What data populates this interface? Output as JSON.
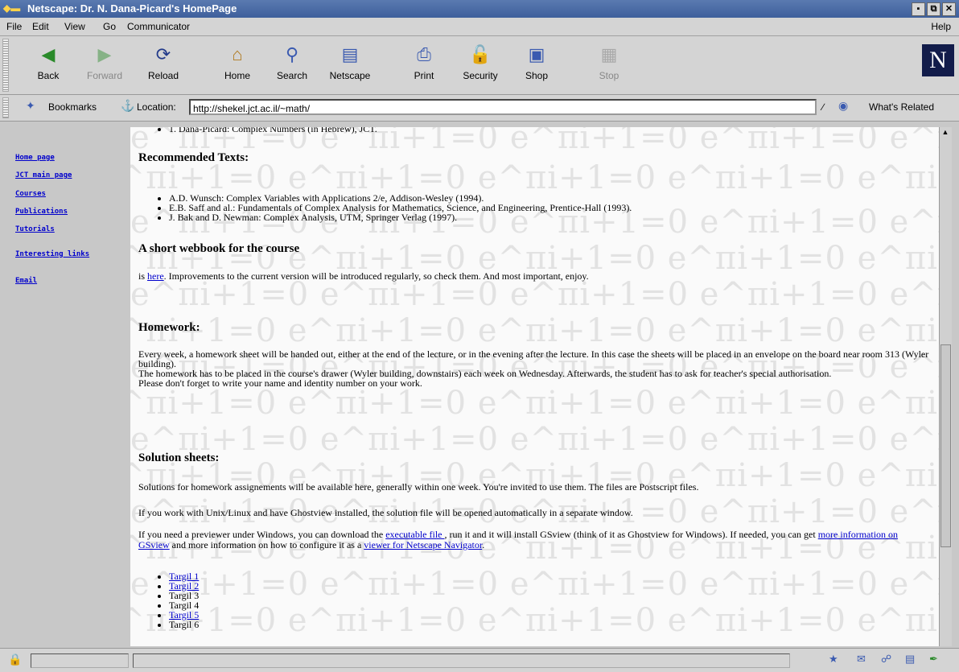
{
  "window": {
    "title": "Netscape: Dr. N. Dana-Picard's HomePage"
  },
  "menu": {
    "items": [
      "File",
      "Edit",
      "View",
      "Go",
      "Communicator"
    ],
    "help": "Help"
  },
  "toolbar": {
    "buttons": [
      {
        "label": "Back",
        "icon": "back-icon"
      },
      {
        "label": "Forward",
        "icon": "forward-icon"
      },
      {
        "label": "Reload",
        "icon": "reload-icon"
      },
      {
        "label": "Home",
        "icon": "home-icon"
      },
      {
        "label": "Search",
        "icon": "search-icon"
      },
      {
        "label": "Netscape",
        "icon": "netscape-icon"
      },
      {
        "label": "Print",
        "icon": "print-icon"
      },
      {
        "label": "Security",
        "icon": "security-icon"
      },
      {
        "label": "Shop",
        "icon": "shop-icon"
      },
      {
        "label": "Stop",
        "icon": "stop-icon"
      }
    ],
    "logo": "N"
  },
  "location": {
    "bookmarks_label": "Bookmarks",
    "location_label": "Location:",
    "url": "http://shekel.jct.ac.il/~math/",
    "related_label": "What's Related"
  },
  "sidebar": {
    "links": [
      "Home page",
      "JCT main page",
      "Courses",
      "Publications",
      "Tutorials",
      "Interesting links",
      "Email"
    ]
  },
  "content": {
    "top_item": "1. Dana-Picard: Complex Numbers (in Hebrew), JCT.",
    "recommended_heading": "Recommended Texts:",
    "recommended_items": [
      "A.D. Wunsch: Complex Variables with Applications 2/e, Addison-Wesley (1994).",
      "E.B. Saff and al.: Fundamentals of Complex Analysis for Mathematics, Science, and Engineering, Prentice-Hall (1993).",
      "J. Bak and D. Newman: Complex Analysis, UTM, Springer Verlag (1997)."
    ],
    "webbook_heading": "A short webbook for the course",
    "webbook_pre": "is ",
    "webbook_link": "here",
    "webbook_post": ". Improvements to the current version will be introduced regularly, so check them. And most important, enjoy.",
    "homework_heading": "Homework:",
    "homework_p1": "Every week, a homework sheet will be handed out, either at the end of the lecture, or in the evening after the lecture. In this case the sheets will be placed in an envelope on the board near room 313 (Wyler building).",
    "homework_p2": "The homework has to be placed in the course's drawer (Wyler building, downstairs) each week on Wednesday. Afterwards, the student has to ask for teacher's special authorisation.",
    "homework_p3": "Please don't forget to write your name and identity number on your work.",
    "solutions_heading": "Solution sheets:",
    "solutions_p1": "Solutions for homework assignements will be available here, generally within one week. You're invited to use them. The files are Postscript files.",
    "solutions_p2": "If you work with Unix/Linux and have Ghostview installed, the solution file will be opened automatically in a separate window.",
    "solutions_p3_a": "If you need a previewer under Windows, you can download the ",
    "solutions_p3_link1": "executable file ",
    "solutions_p3_b": ", run it and it will install GSview (think of it as Ghostview for Windows). If needed, you can get ",
    "solutions_p3_link2": "more information on GSview",
    "solutions_p3_c": " and more information on how to configure it as a ",
    "solutions_p3_link3": "viewer for Netscape Navigator",
    "solutions_p3_d": ".",
    "targil": [
      {
        "label": "Targil 1",
        "link": true
      },
      {
        "label": "Targil 2",
        "link": true
      },
      {
        "label": "Targil 3",
        "link": false
      },
      {
        "label": "Targil 4",
        "link": false
      },
      {
        "label": "Targil 5",
        "link": true
      },
      {
        "label": "Targil 6",
        "link": false
      }
    ],
    "watermark": "e^πi+1=0 e^πi+1=0 e^πi+1=0 e^πi+1=0 e^πi+1=0"
  },
  "colors": {
    "link": "#0000cc",
    "titlebar": "#4a6aa8",
    "chrome": "#d4d4d4"
  }
}
